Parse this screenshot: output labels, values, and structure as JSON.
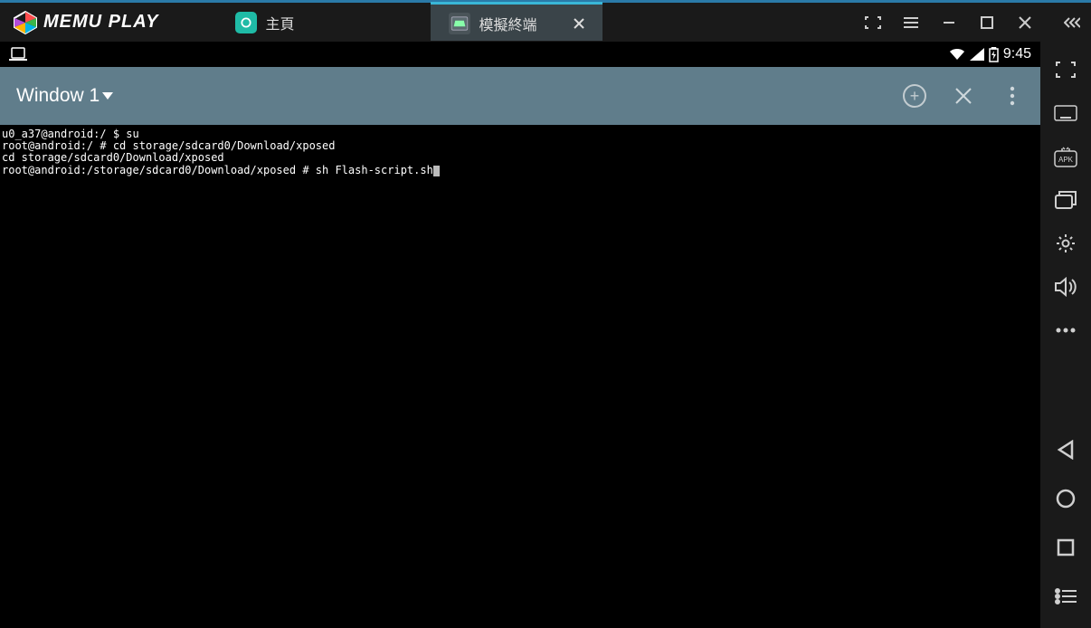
{
  "titlebar": {
    "brand": "MEMU PLAY",
    "tabs": {
      "home": {
        "label": "主頁"
      },
      "terminal": {
        "label": "模擬終端"
      }
    }
  },
  "statusbar": {
    "time": "9:45"
  },
  "app": {
    "title": "Window 1"
  },
  "terminal": {
    "line1_prompt": "u0_a37@android:/ $ ",
    "line1_cmd": "su",
    "line2_prompt": "root@android:/ # ",
    "line2_cmd": "cd storage/sdcard0/Download/xposed",
    "line3": "cd storage/sdcard0/Download/xposed",
    "line4_prompt": "root@android:/storage/sdcard0/Download/xposed # ",
    "line4_cmd": "sh Flash-script.sh"
  },
  "icons": {
    "home_tab": "home-icon",
    "terminal_tab": "terminal-icon",
    "close": "close-icon",
    "fullscreen_corners": "fullscreen-corners-icon",
    "menu_lines": "menu-lines-icon",
    "minimize": "minimize-icon",
    "maximize": "maximize-icon",
    "window_close": "window-close-icon",
    "sidebar_expand": "sidebar-expand-icon",
    "wifi": "wifi-icon",
    "signal": "signal-icon",
    "battery": "battery-icon",
    "laptop": "laptop-icon",
    "dropdown": "dropdown-icon",
    "add": "add-icon",
    "tab_close": "close-icon",
    "kebab": "kebab-icon",
    "fullscreen": "fullscreen-icon",
    "keyboard": "keyboard-icon",
    "apk": "apk-icon",
    "multi_window": "multi-window-icon",
    "gear": "gear-icon",
    "volume": "volume-icon",
    "more": "more-icon",
    "back": "back-icon",
    "home_nav": "home-nav-icon",
    "recent": "recent-icon",
    "list": "list-icon"
  }
}
